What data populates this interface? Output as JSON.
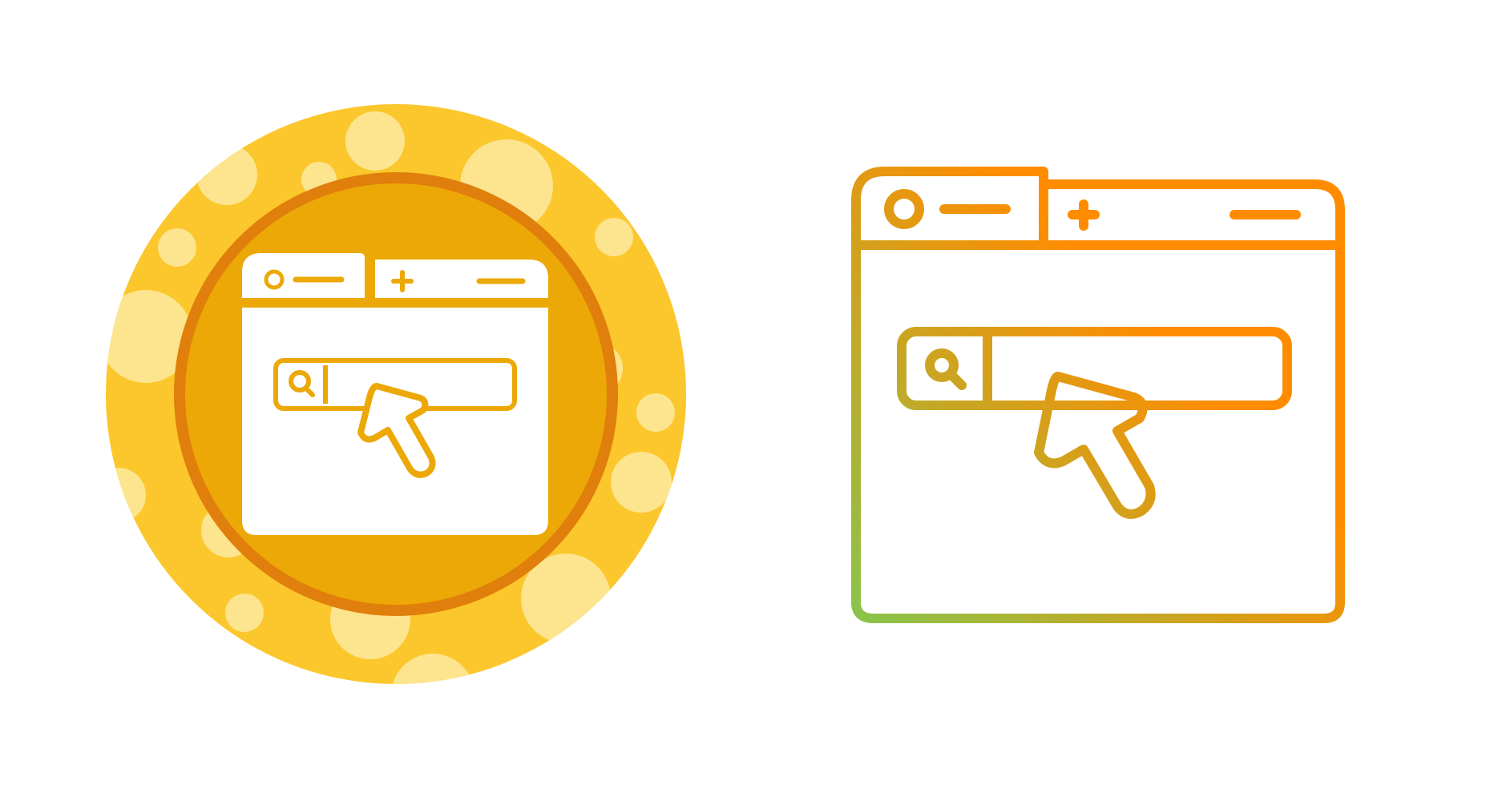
{
  "icons": [
    {
      "name": "browser-search-click-icon",
      "style": "glyph-badge",
      "colors": {
        "badge_outer": "#FBC72C",
        "badge_bubble": "#FDE48E",
        "badge_inner": "#ECA806",
        "badge_ring": "#E07F0C",
        "glyph_fill": "#FFFFFF",
        "glyph_line": "#ECA806"
      }
    },
    {
      "name": "browser-search-click-icon",
      "style": "gradient-outline",
      "colors": {
        "gradient_start": "#8BC34A",
        "gradient_end": "#FF8C00"
      }
    }
  ]
}
